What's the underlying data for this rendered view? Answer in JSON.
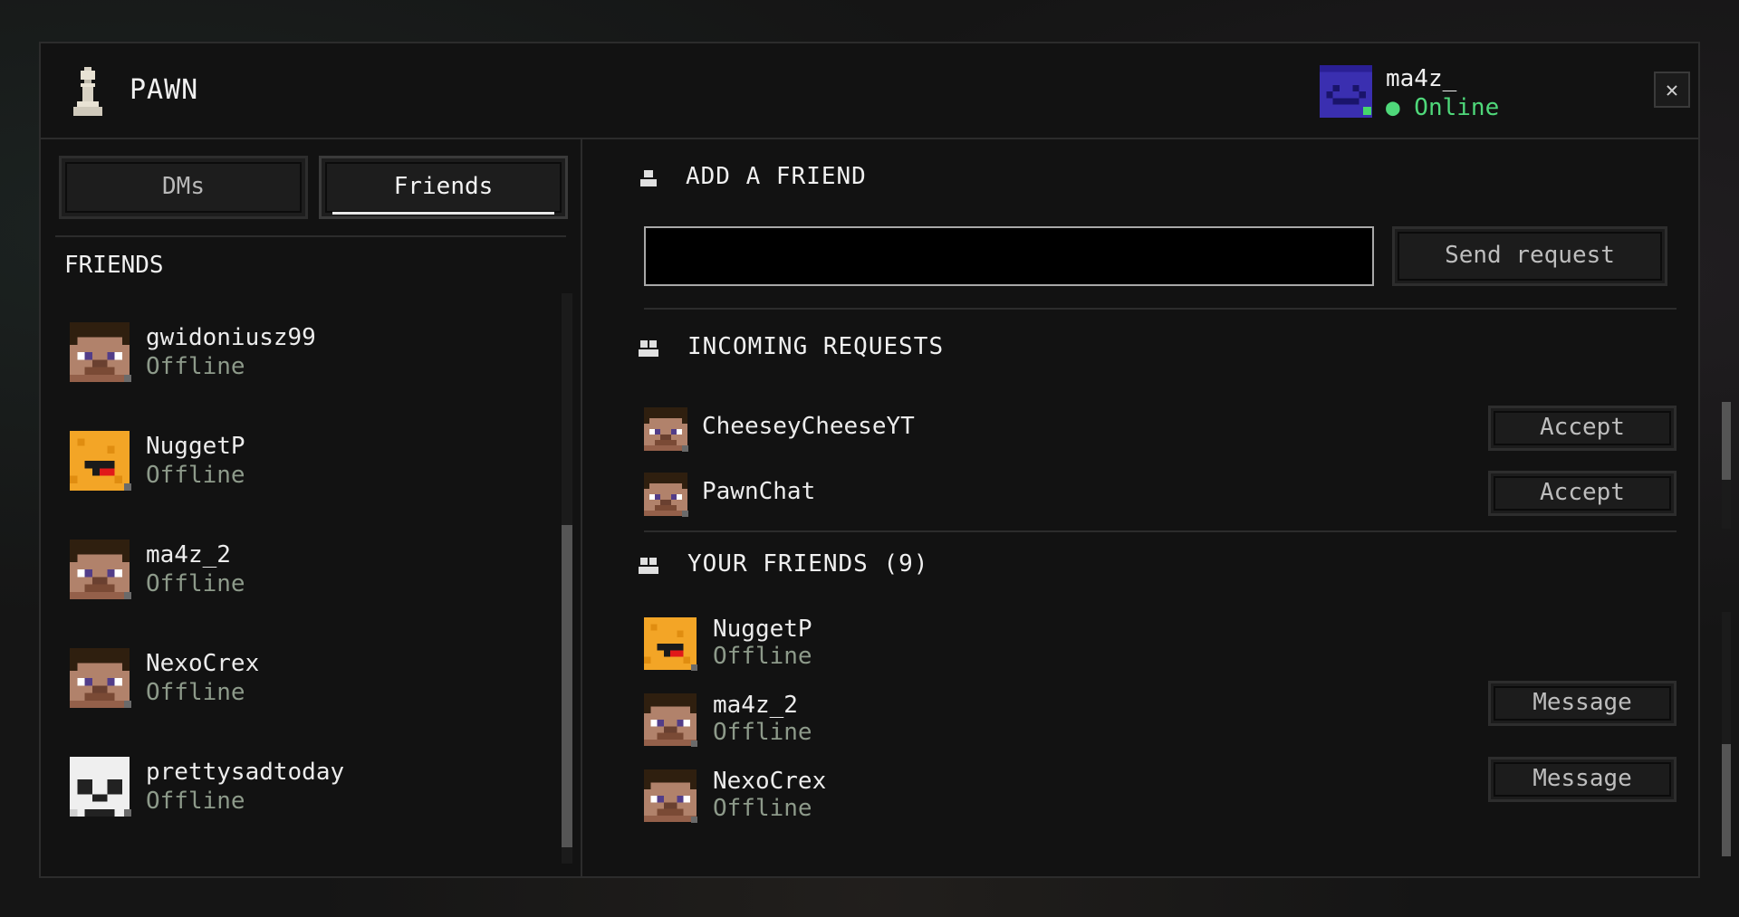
{
  "app": {
    "name": "PAWN"
  },
  "user": {
    "name": "ma4z_",
    "status": "● Online"
  },
  "colors": {
    "online": "#4fd87a",
    "offline_text": "#8d9a8a",
    "accent_text": "#f0f0f0"
  },
  "tabs": [
    {
      "label": "DMs",
      "active": false
    },
    {
      "label": "Friends",
      "active": true
    }
  ],
  "sidebar": {
    "title": "FRIENDS",
    "friends": [
      {
        "name": "gwidoniusz99",
        "status": "Offline",
        "avatar": "steve-head-icon"
      },
      {
        "name": "NuggetP",
        "status": "Offline",
        "avatar": "nugget-head-icon"
      },
      {
        "name": "ma4z_2",
        "status": "Offline",
        "avatar": "steve-head-icon"
      },
      {
        "name": "NexoCrex",
        "status": "Offline",
        "avatar": "steve-head-icon"
      },
      {
        "name": "prettysadtoday",
        "status": "Offline",
        "avatar": "panda-head-icon"
      }
    ]
  },
  "add_friend": {
    "title": "ADD A FRIEND",
    "input_value": "",
    "input_placeholder": "",
    "send_label": "Send request"
  },
  "incoming": {
    "title": "INCOMING REQUESTS",
    "requests": [
      {
        "name": "CheeseyCheeseYT",
        "accept_label": "Accept"
      },
      {
        "name": "PawnChat",
        "accept_label": "Accept"
      }
    ]
  },
  "your_friends": {
    "title": "YOUR FRIENDS (9)",
    "items": [
      {
        "name": "NuggetP",
        "status": "Offline",
        "message_label": ""
      },
      {
        "name": "ma4z_2",
        "status": "Offline",
        "message_label": "Message"
      },
      {
        "name": "NexoCrex",
        "status": "Offline",
        "message_label": "Message"
      }
    ]
  },
  "close_label": "✕"
}
